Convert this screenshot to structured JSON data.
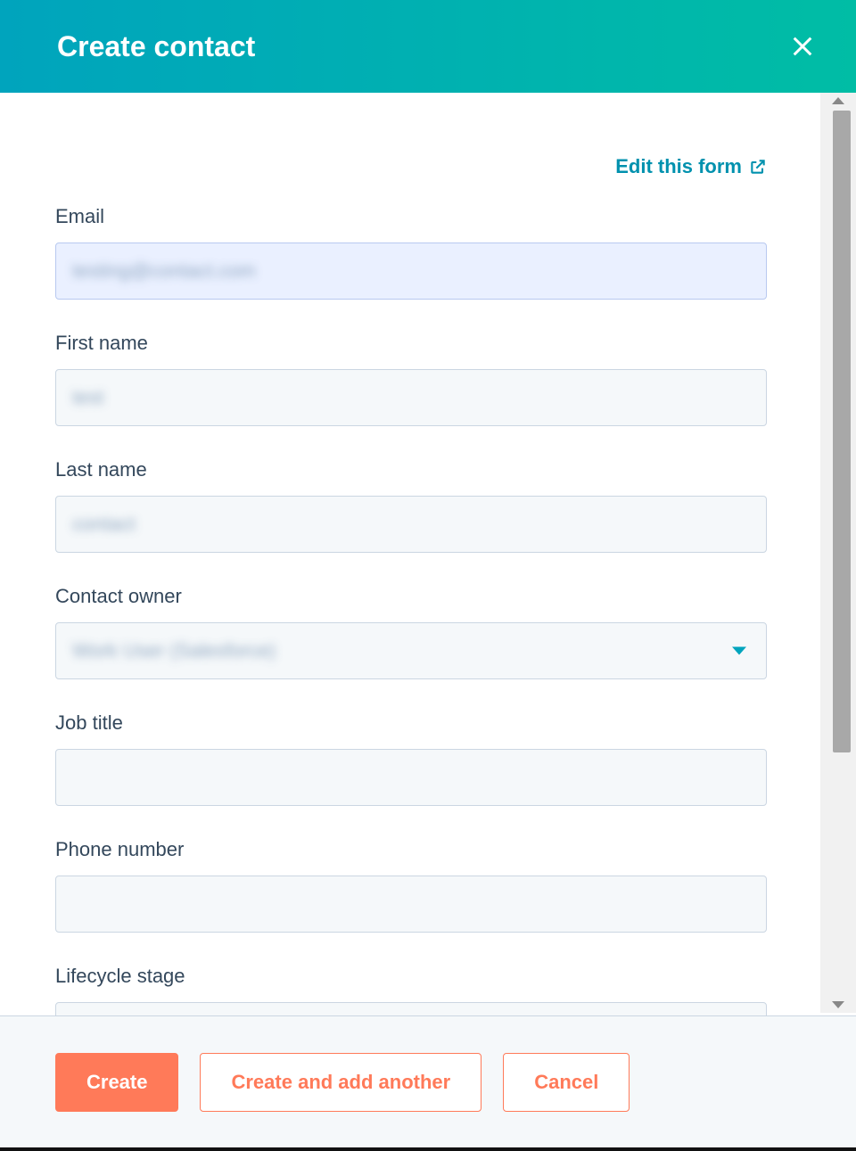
{
  "header": {
    "title": "Create contact"
  },
  "editLink": "Edit this form",
  "fields": {
    "email": {
      "label": "Email",
      "value": "testing@contact.com"
    },
    "firstName": {
      "label": "First name",
      "value": "test"
    },
    "lastName": {
      "label": "Last name",
      "value": "contact"
    },
    "contactOwner": {
      "label": "Contact owner",
      "value": "Work User (Salesforce)"
    },
    "jobTitle": {
      "label": "Job title",
      "value": ""
    },
    "phone": {
      "label": "Phone number",
      "value": ""
    },
    "lifecycle": {
      "label": "Lifecycle stage",
      "value": ""
    }
  },
  "footer": {
    "create": "Create",
    "createAnother": "Create and add another",
    "cancel": "Cancel"
  }
}
